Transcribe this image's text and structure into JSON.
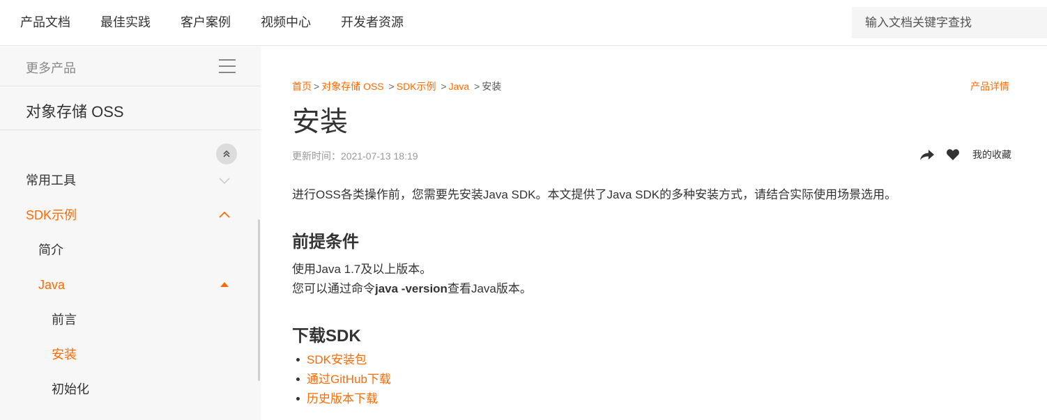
{
  "topnav": {
    "items": [
      "产品文档",
      "最佳实践",
      "客户案例",
      "视频中心",
      "开发者资源"
    ],
    "search_placeholder": "输入文档关键字查找"
  },
  "sidebar": {
    "more_products": "更多产品",
    "product_title": "对象存储 OSS",
    "menu": [
      {
        "label": "常用工具",
        "state": "collapsed",
        "active": false
      },
      {
        "label": "SDK示例",
        "state": "expanded",
        "active": true
      },
      {
        "label": "简介",
        "active": false
      },
      {
        "label": "Java",
        "state": "expanded",
        "active": true
      },
      {
        "label": "前言",
        "active": false
      },
      {
        "label": "安装",
        "active": true
      },
      {
        "label": "初始化",
        "active": false
      }
    ]
  },
  "main": {
    "breadcrumb": [
      "首页",
      "对象存储 OSS",
      "SDK示例",
      "Java"
    ],
    "breadcrumb_current": "安装",
    "product_detail": "产品详情",
    "title": "安装",
    "update_time": "更新时间：2021-07-13 18:19",
    "favorite_label": "我的收藏",
    "intro": "进行OSS各类操作前，您需要先安装Java SDK。本文提供了Java SDK的多种安装方式，请结合实际使用场景选用。",
    "prereq": {
      "heading": "前提条件",
      "line1": "使用Java 1.7及以上版本。",
      "line2_prefix": "您可以通过命令",
      "line2_cmd": "java -version",
      "line2_suffix": "查看Java版本。"
    },
    "download": {
      "heading": "下载SDK",
      "links": [
        "SDK安装包",
        "通过GitHub下载",
        "历史版本下载"
      ]
    }
  },
  "colors": {
    "accent": "#ff6a00",
    "sidebar_bg": "#f7f7f7"
  }
}
